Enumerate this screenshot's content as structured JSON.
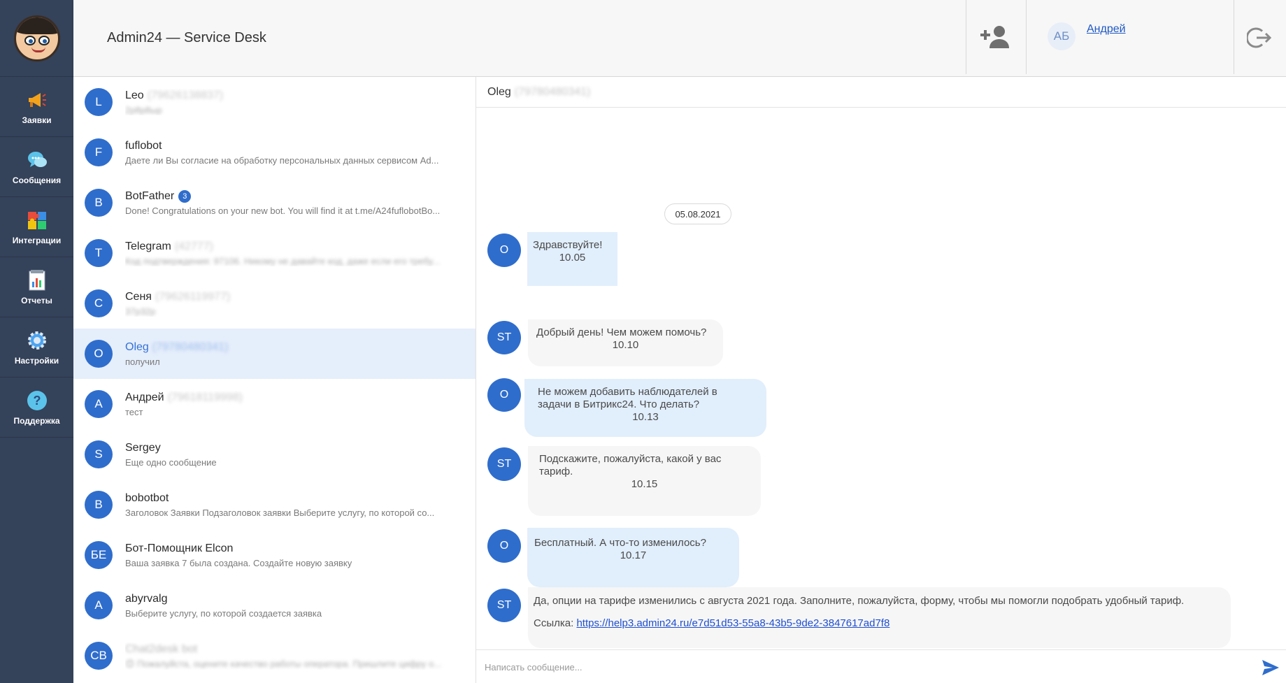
{
  "app": {
    "title": "Admin24 — Service Desk"
  },
  "sidebar": {
    "items": [
      {
        "label": "Заявки",
        "icon": "megaphone-icon"
      },
      {
        "label": "Сообщения",
        "icon": "chat-bubbles-icon"
      },
      {
        "label": "Интеграции",
        "icon": "puzzle-icon"
      },
      {
        "label": "Отчеты",
        "icon": "report-icon"
      },
      {
        "label": "Настройки",
        "icon": "gear-icon"
      },
      {
        "label": "Поддержка",
        "icon": "help-icon"
      }
    ]
  },
  "header": {
    "user_initials": "АБ",
    "user_name": "Андрей"
  },
  "contacts": [
    {
      "initials": "L",
      "name": "Leo",
      "phone": "(79626138837)",
      "preview": "2р8р8ыр",
      "preview_blur": true
    },
    {
      "initials": "F",
      "name": "fuflobot",
      "preview": "Даете ли Вы согласие на обработку персональных данных сервисом Ad..."
    },
    {
      "initials": "B",
      "name": "BotFather",
      "badge": "3",
      "preview": "Done! Congratulations on your new bot. You will find it at t.me/A24fuflobotBo..."
    },
    {
      "initials": "T",
      "name": "Telegram",
      "phone": "(42777)",
      "preview": "Код подтверждения: 97106. Никому не давайте код, даже если его требу...",
      "preview_blur": true
    },
    {
      "initials": "C",
      "name": "Сеня",
      "phone": "(79626119977)",
      "preview": "37р32р",
      "preview_blur": true
    },
    {
      "initials": "O",
      "name": "Oleg",
      "phone": "(79780480341)",
      "preview": "получил",
      "active": true
    },
    {
      "initials": "А",
      "name": "Андрей",
      "phone": "(79618119998)",
      "preview": "тест"
    },
    {
      "initials": "S",
      "name": "Sergey",
      "preview": "Еще одно сообщение"
    },
    {
      "initials": "B",
      "name": "bobotbot",
      "preview": "Заголовок Заявки Подзаголовок заявки Выберите услугу, по которой со..."
    },
    {
      "initials": "БЕ",
      "name": "Бот-Помощник Elcon",
      "preview": "Ваша заявка 7 была создана. Создайте новую заявку"
    },
    {
      "initials": "A",
      "name": "abyrvalg",
      "preview": "Выберите услугу, по которой создается заявка"
    },
    {
      "initials": "CB",
      "name": "Chat2desk bot",
      "name_blur": true,
      "preview": "😊 Пожалуйста, оцените качество работы оператора. Пришлите цифру о...",
      "preview_blur": true
    }
  ],
  "chat": {
    "contact_name": "Oleg",
    "contact_phone": "(79780480341)",
    "date": "05.08.2021",
    "messages": [
      {
        "initials": "O",
        "text": "Здравствуйте!",
        "time": "10.05"
      },
      {
        "initials": "ST",
        "text": "Добрый день! Чем можем помочь?",
        "time": "10.10"
      },
      {
        "initials": "O",
        "text": "Не можем добавить наблюдателей в задачи в Битрикс24. Что делать?",
        "time": "10.13"
      },
      {
        "initials": "ST",
        "text": "Подскажите, пожалуйста, какой у вас тариф.",
        "time": "10.15"
      },
      {
        "initials": "O",
        "text": "Бесплатный. А что-то изменилось?",
        "time": "10.17"
      },
      {
        "initials": "ST",
        "text": "Да, опции на тарифе изменились с августа 2021 года. Заполните, пожалуйста, форму, чтобы мы помогли подобрать удобный тариф.",
        "link_label": "Ссылка:",
        "link": "https://help3.admin24.ru/e7d51d53-55a8-43b5-9de2-3847617ad7f8"
      }
    ],
    "composer_placeholder": "Написать сообщение..."
  }
}
